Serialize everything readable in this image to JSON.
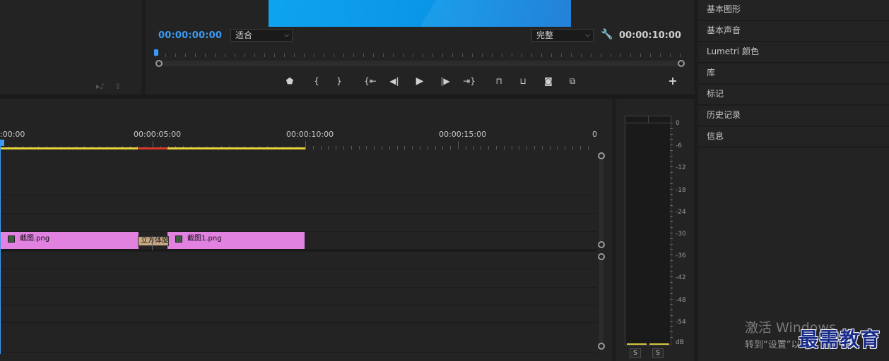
{
  "program_monitor": {
    "current_timecode": "00:00:00:00",
    "zoom_select": "适合",
    "quality_select": "完整",
    "duration_timecode": "00:00:10:00",
    "transport_buttons": [
      {
        "name": "add-marker",
        "glyph": "⬟"
      },
      {
        "name": "mark-in",
        "glyph": "{"
      },
      {
        "name": "mark-out",
        "glyph": "}"
      },
      {
        "name": "go-to-in",
        "glyph": "{⇤"
      },
      {
        "name": "step-back",
        "glyph": "◀|"
      },
      {
        "name": "play",
        "glyph": "▶"
      },
      {
        "name": "step-forward",
        "glyph": "|▶"
      },
      {
        "name": "go-to-out",
        "glyph": "⇥}"
      },
      {
        "name": "lift",
        "glyph": "⬚"
      },
      {
        "name": "extract",
        "glyph": "⬚"
      },
      {
        "name": "export-frame",
        "glyph": "📷"
      },
      {
        "name": "comparison-view",
        "glyph": "⧉"
      },
      {
        "name": "add-button",
        "glyph": "+"
      }
    ]
  },
  "right_panels": [
    {
      "label": "基本图形"
    },
    {
      "label": "基本声音"
    },
    {
      "label": "Lumetri 颜色"
    },
    {
      "label": "库"
    },
    {
      "label": "标记"
    },
    {
      "label": "历史记录"
    },
    {
      "label": "信息"
    }
  ],
  "timeline": {
    "ruler_labels": [
      ":00:00",
      "00:00:05:00",
      "00:00:10:00",
      "00:00:15:00",
      "0"
    ],
    "clips": [
      {
        "label": "截图.png"
      },
      {
        "label": "截图1.png"
      }
    ],
    "transition_label": "立方体旋转"
  },
  "audio_meter": {
    "db_labels": [
      "0",
      "-6",
      "-12",
      "-18",
      "-24",
      "-30",
      "-36",
      "-42",
      "-48",
      "-54",
      "dB"
    ],
    "solo_buttons": [
      "S",
      "S"
    ]
  },
  "overlay": {
    "windows_activation_line1": "激活 Windows",
    "windows_activation_line2": "转到“设置”以",
    "brand_watermark": "最需教育"
  },
  "colors": {
    "accent_blue": "#3a9bf5",
    "clip_pink": "#e181e0",
    "work_area_yellow": "#e6d23a",
    "render_red": "#d43a2a"
  }
}
